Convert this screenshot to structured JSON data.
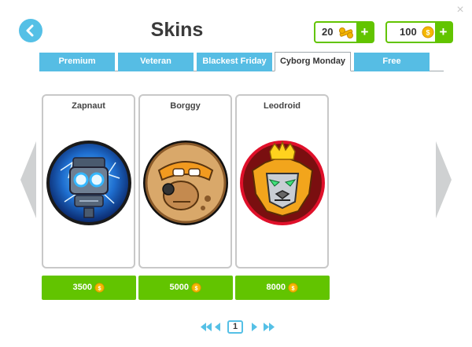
{
  "header": {
    "title": "Skins",
    "close_label": "×"
  },
  "currencies": {
    "bolts": {
      "value": "20",
      "icon": "bolt-icon",
      "plus_label": "+"
    },
    "coins": {
      "value": "100",
      "icon": "coin-icon",
      "plus_label": "+"
    }
  },
  "tabs": [
    {
      "label": "Premium",
      "active": false
    },
    {
      "label": "Veteran",
      "active": false
    },
    {
      "label": "Blackest Friday",
      "active": false
    },
    {
      "label": "Cyborg Monday",
      "active": true
    },
    {
      "label": "Free",
      "active": false
    }
  ],
  "skins": [
    {
      "name": "Zapnaut",
      "price": "3500",
      "avatar": "robot-avatar"
    },
    {
      "name": "Borggy",
      "price": "5000",
      "avatar": "cyborg-bear-avatar"
    },
    {
      "name": "Leodroid",
      "price": "8000",
      "avatar": "lion-robot-avatar"
    }
  ],
  "pagination": {
    "current_page": "1"
  },
  "colors": {
    "accent_blue": "#56bde4",
    "accent_green": "#62c400",
    "coin_gold": "#f5b800"
  }
}
